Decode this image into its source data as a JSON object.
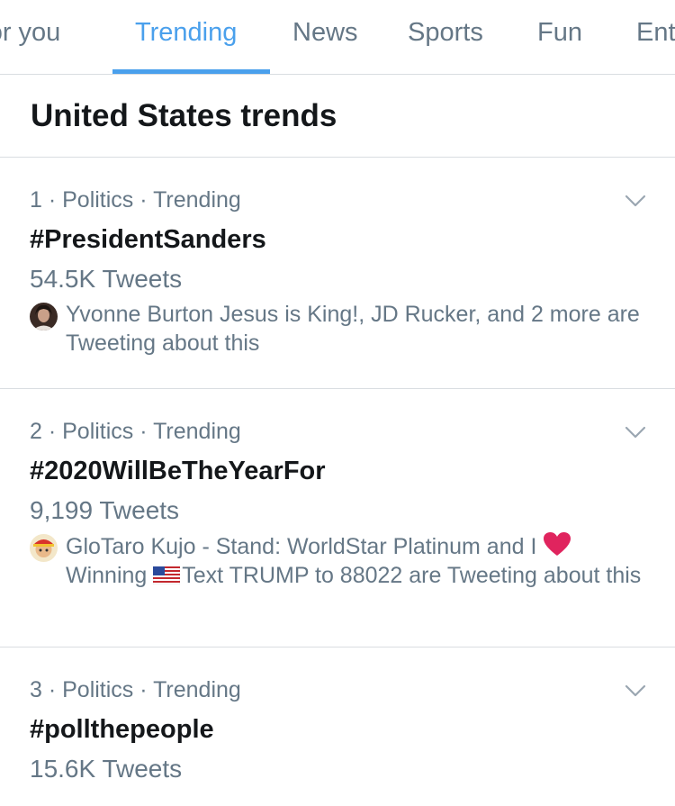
{
  "tabs": [
    {
      "label": "For you"
    },
    {
      "label": "Trending"
    },
    {
      "label": "News"
    },
    {
      "label": "Sports"
    },
    {
      "label": "Fun"
    },
    {
      "label": "Entertainment"
    }
  ],
  "active_tab": "Trending",
  "section": {
    "title": "United States trends"
  },
  "trends": [
    {
      "meta": "1 · Politics · Trending",
      "name": "#PresidentSanders",
      "count": "54.5K Tweets",
      "context": "Yvonne Burton Jesus is King!, JD Rucker, and 2 more are Tweeting about this"
    },
    {
      "meta": "2 · Politics · Trending",
      "name": "#2020WillBeTheYearFor",
      "count": "9,199 Tweets",
      "context_a": "GloTaro Kujo - Stand: WorldStar Platinum and I",
      "context_b": "Winning",
      "context_c": "Text TRUMP to 88022 are Tweeting about this"
    },
    {
      "meta": "3 · Politics · Trending",
      "name": "#pollthepeople",
      "count": "15.6K Tweets"
    }
  ],
  "icons": {
    "chevron": "chevron-down-icon",
    "heart": "red-heart-emoji",
    "flag": "us-flag-emoji"
  },
  "colors": {
    "accent": "#4aa0ec",
    "secondary_text": "#657786",
    "primary_text": "#14171a",
    "divider": "#d9dde1",
    "heart": "#e0245e"
  }
}
